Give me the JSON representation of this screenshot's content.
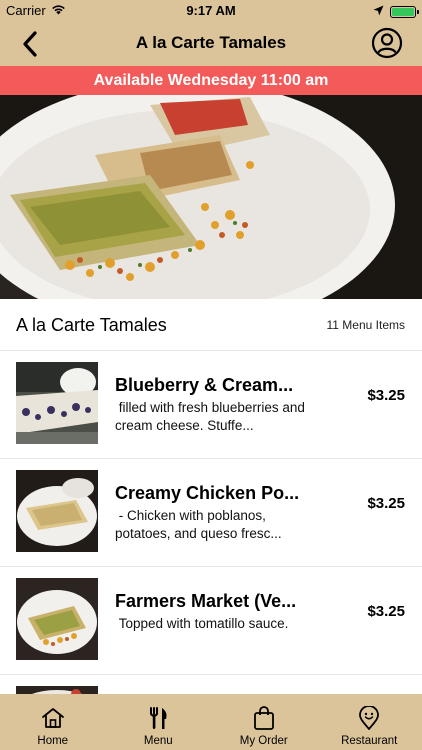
{
  "status_bar": {
    "carrier": "Carrier",
    "time": "9:17 AM"
  },
  "nav": {
    "title": "A la Carte Tamales"
  },
  "banner": {
    "text": "Available Wednesday 11:00 am"
  },
  "section": {
    "title": "A la Carte Tamales",
    "count": "11 Menu Items"
  },
  "menu_items": [
    {
      "name": "Blueberry & Cream...",
      "description": " filled with fresh blueberries and cream cheese. Stuffe...",
      "price": "$3.25"
    },
    {
      "name": "Creamy Chicken Po...",
      "description": " - Chicken with poblanos, potatoes, and queso fresc...",
      "price": "$3.25"
    },
    {
      "name": "Farmers Market (Ve...",
      "description": " Topped with tomatillo sauce.",
      "price": "$3.25"
    }
  ],
  "tabs": [
    {
      "label": "Home",
      "icon": "home-icon"
    },
    {
      "label": "Menu",
      "icon": "fork-knife-icon"
    },
    {
      "label": "My Order",
      "icon": "shopping-bag-icon"
    },
    {
      "label": "Restaurant",
      "icon": "location-pin-icon"
    }
  ],
  "colors": {
    "nav_background": "#dcc49a",
    "banner_background": "#f25b5a",
    "banner_text": "#ffffff",
    "battery": "#35c759"
  }
}
